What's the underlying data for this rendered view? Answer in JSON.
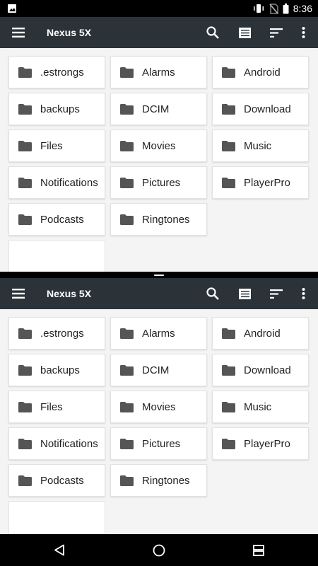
{
  "status_bar": {
    "time": "8:36",
    "icons": [
      "image-notification-icon",
      "vibrate-icon",
      "no-sim-icon",
      "battery-icon"
    ]
  },
  "panes": [
    {
      "title": "Nexus 5X",
      "actions": [
        "menu-icon",
        "search-icon",
        "list-view-icon",
        "sort-icon",
        "more-vert-icon"
      ],
      "folders": [
        ".estrongs",
        "Alarms",
        "Android",
        "backups",
        "DCIM",
        "Download",
        "Files",
        "Movies",
        "Music",
        "Notifications",
        "Pictures",
        "PlayerPro",
        "Podcasts",
        "Ringtones"
      ]
    },
    {
      "title": "Nexus 5X",
      "actions": [
        "menu-icon",
        "search-icon",
        "list-view-icon",
        "sort-icon",
        "more-vert-icon"
      ],
      "folders": [
        ".estrongs",
        "Alarms",
        "Android",
        "backups",
        "DCIM",
        "Download",
        "Files",
        "Movies",
        "Music",
        "Notifications",
        "Pictures",
        "PlayerPro",
        "Podcasts",
        "Ringtones"
      ]
    }
  ],
  "nav_bar": {
    "buttons": [
      "back-icon",
      "home-icon",
      "recents-icon"
    ]
  },
  "colors": {
    "toolbar": "#2b3339",
    "folder_icon": "#555555",
    "background": "#f4f4f4"
  }
}
